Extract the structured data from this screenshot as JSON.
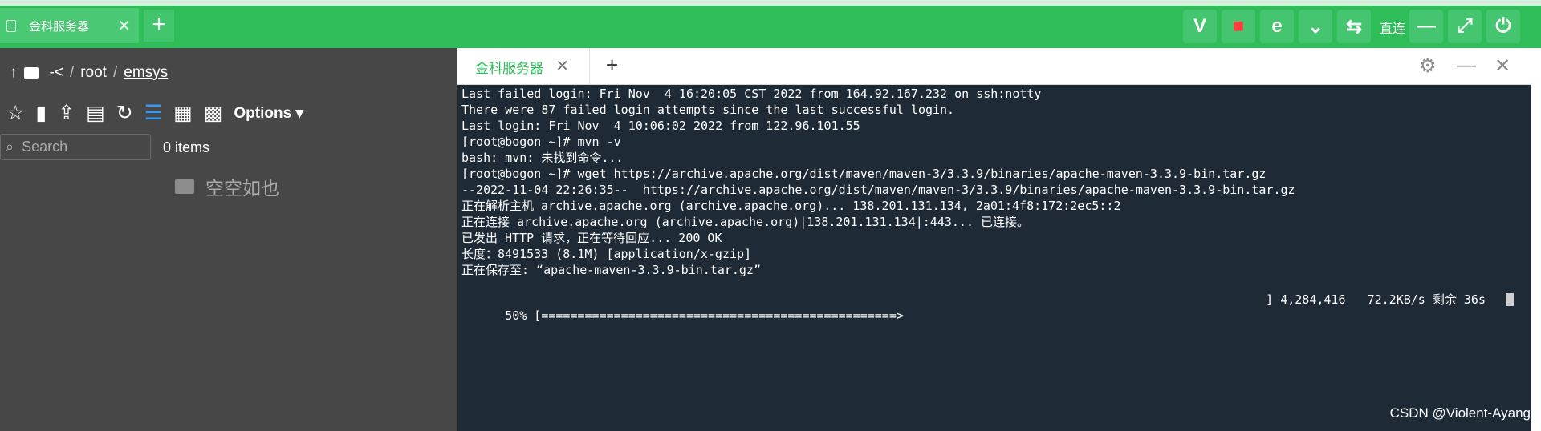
{
  "topbar": {
    "tab_label": "金科服务器",
    "tab_close": "✕",
    "new_tab": "+",
    "vip_label": "V",
    "direct_label": "直连"
  },
  "left": {
    "breadcrumb": {
      "up": "↑",
      "root": "-<",
      "sep": "/",
      "dir": "root",
      "sep2": "/",
      "current": "emsys"
    },
    "toolbar": {
      "options": "Options ▾"
    },
    "search_placeholder": "Search",
    "item_count": "0 items",
    "empty_text": "空空如也"
  },
  "panel": {
    "tab_label": "金科服务器",
    "tab_close": "✕",
    "new_tab": "+"
  },
  "terminal": {
    "lines": [
      "Last failed login: Fri Nov  4 16:20:05 CST 2022 from 164.92.167.232 on ssh:notty",
      "There were 87 failed login attempts since the last successful login.",
      "Last login: Fri Nov  4 10:06:02 2022 from 122.96.101.55",
      "[root@bogon ~]# mvn -v",
      "bash: mvn: 未找到命令...",
      "[root@bogon ~]# wget https://archive.apache.org/dist/maven/maven-3/3.3.9/binaries/apache-maven-3.3.9-bin.tar.gz",
      "--2022-11-04 22:26:35--  https://archive.apache.org/dist/maven/maven-3/3.3.9/binaries/apache-maven-3.3.9-bin.tar.gz",
      "正在解析主机 archive.apache.org (archive.apache.org)... 138.201.131.134, 2a01:4f8:172:2ec5::2",
      "正在连接 archive.apache.org (archive.apache.org)|138.201.131.134|:443... 已连接。",
      "已发出 HTTP 请求，正在等待回应... 200 OK",
      "长度：8491533 (8.1M) [application/x-gzip]",
      "正在保存至: “apache-maven-3.3.9-bin.tar.gz”"
    ],
    "progress_left": "50% [=================================================>",
    "progress_right": "] 4,284,416   72.2KB/s 剩余 36s",
    "progress_percent": 50
  },
  "watermark": "CSDN @Violent-Ayang"
}
